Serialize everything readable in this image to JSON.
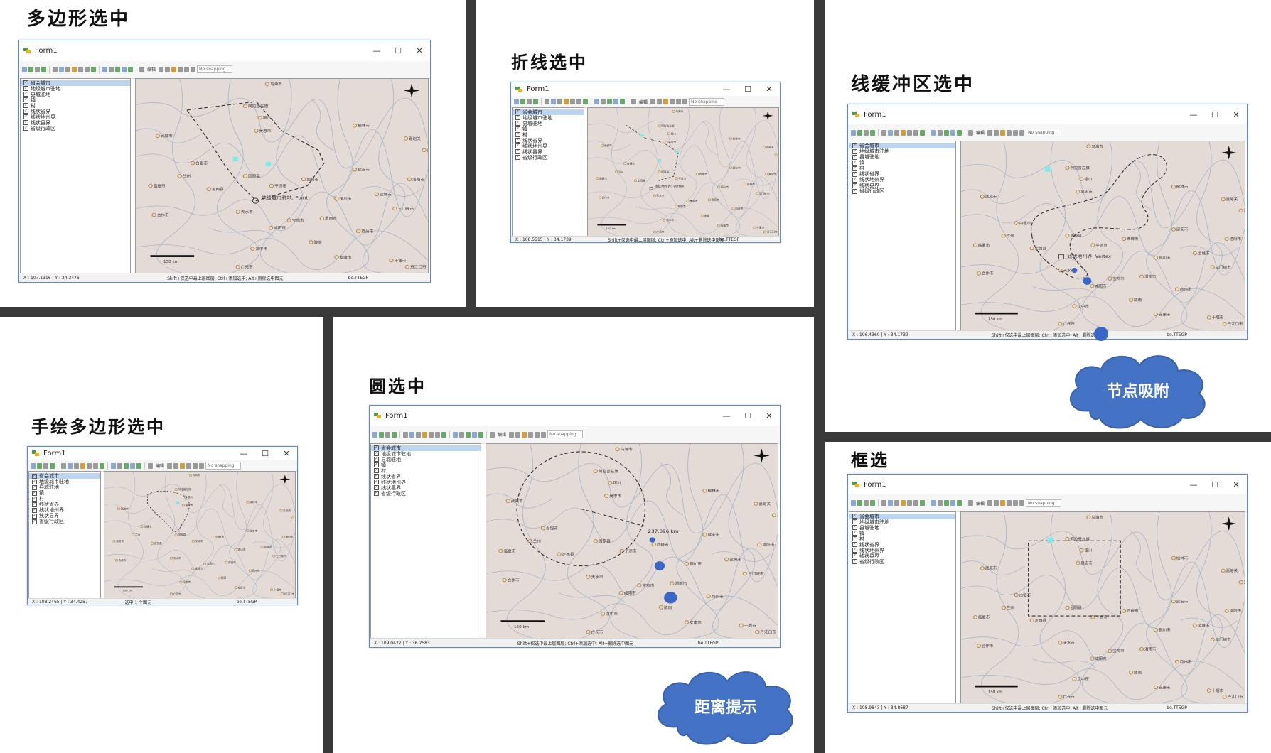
{
  "window": {
    "title": "Form1",
    "layers": [
      "省会城市",
      "地级城市驻地",
      "县城驻地",
      "镇",
      "村",
      "线状省界",
      "线状地州界",
      "线状县界",
      "省级行政区"
    ],
    "toolbar": {
      "edit_label": "编辑",
      "snapping_placeholder": "No snapping"
    },
    "status_hint": "Shift+仅选中最上层图层; Ctrl+添加选中; Alt+删除选中图元",
    "status_hint_count": "选中 1 个图元",
    "status_be": "be.TTEGP"
  },
  "panels": [
    {
      "title": "多边形选中",
      "coord": "X : 107.1316  |  Y : 34.3476",
      "tooltip": "地级城市驻地: Point"
    },
    {
      "title": "折线选中",
      "coord": "X : 108.5515  |  Y : 34.1739",
      "tooltip": "线状地州界: Vertex"
    },
    {
      "title": "线缓冲区选中",
      "coord": "X : 106.4360  |  Y : 34.1739",
      "tooltip": "线状地州界: Vertex"
    },
    {
      "title": "手绘多边形选中",
      "coord": "X : 108.2465  |  Y : 34.4257"
    },
    {
      "title": "圆选中",
      "coord": "X : 109.0422  |  Y : 36.2583",
      "distance": "237.096 km"
    },
    {
      "title": "框选",
      "coord": "X : 108.9843  |  Y : 34.8687"
    }
  ],
  "map": {
    "scale_label": "150 km",
    "cities": [
      "乌海市",
      "阿拉善左旗",
      "银川",
      "吴忠市",
      "武威市",
      "榆林市",
      "嘉峪关",
      "白银市",
      "兰州",
      "固原县",
      "平凉市",
      "西峰市",
      "延安市",
      "临夏市",
      "定西县",
      "铜川市",
      "运城市",
      "合作市",
      "天水市",
      "宝鸡市",
      "咸阳市",
      "渭南市",
      "三门峡市",
      "陇南",
      "商州市",
      "汉中市",
      "安康市",
      "十堰市",
      "丹江口市",
      "广元市",
      "洛阳市",
      "吕梁市"
    ]
  },
  "callouts": {
    "snap": "节点吸附",
    "distance": "距离提示"
  },
  "colors": {
    "map_bg": "#e5dbd6",
    "selected_fill": "#7fe8e8",
    "snap_dot": "#3a66c8",
    "cloud": "#4472c4"
  }
}
